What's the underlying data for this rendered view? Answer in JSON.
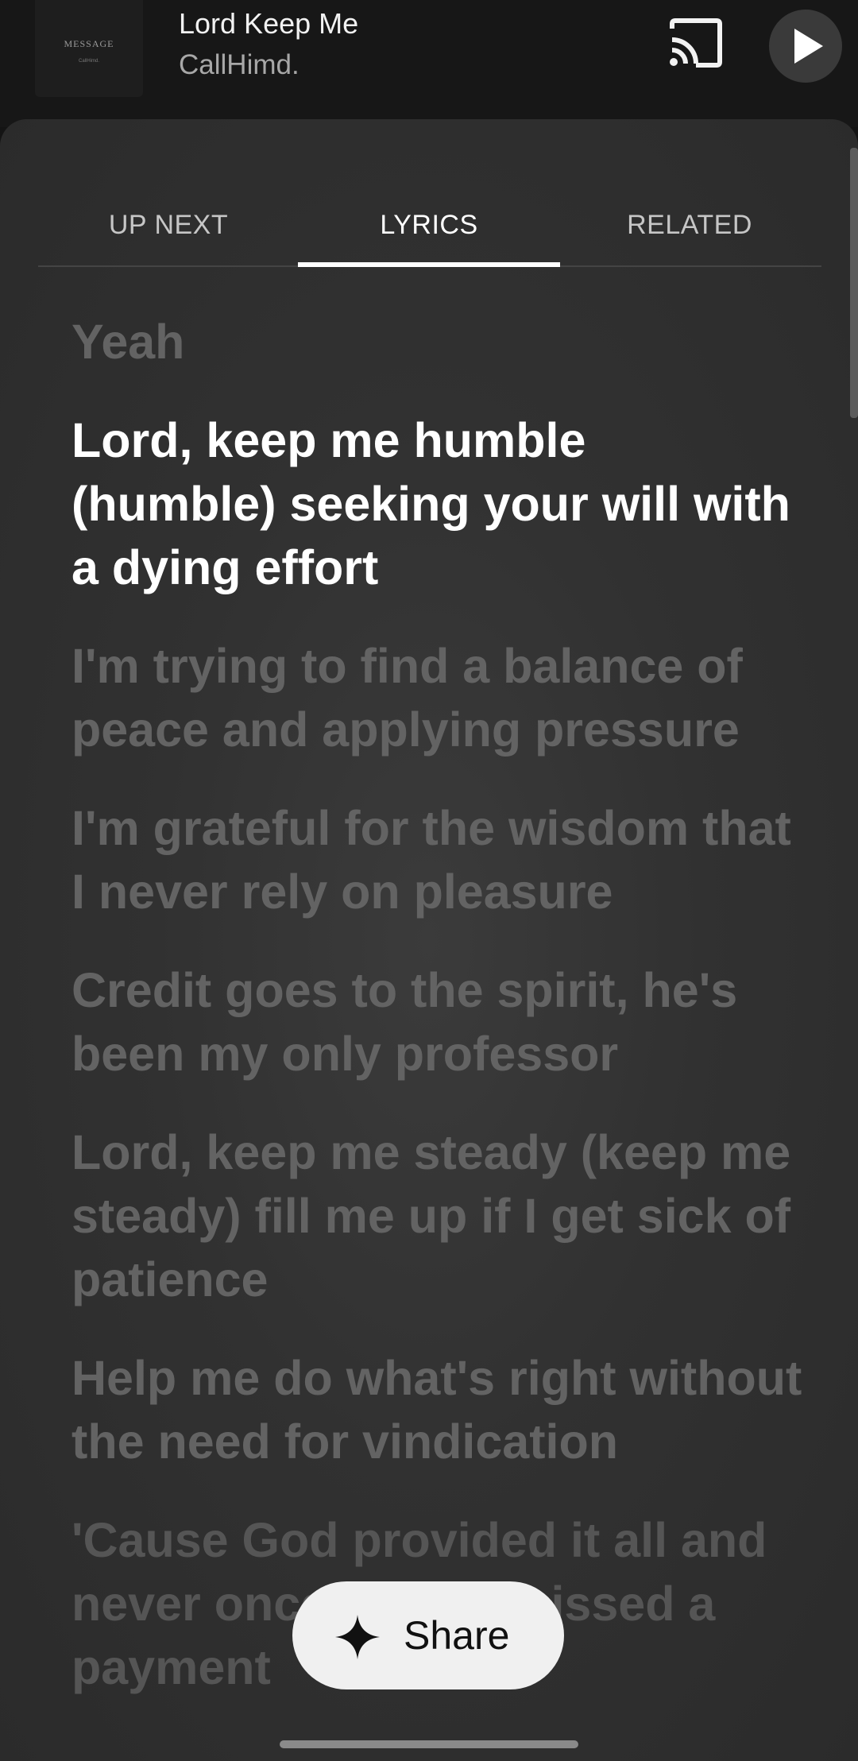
{
  "mini_player": {
    "album_art": {
      "title": "MESSAGE",
      "subtitle": "CallHimd."
    },
    "track_title": "Lord Keep Me",
    "artist": "CallHimd.",
    "cast_icon": "cast-icon",
    "play_icon": "play-icon"
  },
  "tabs": [
    {
      "label": "UP NEXT",
      "active": false
    },
    {
      "label": "LYRICS",
      "active": true
    },
    {
      "label": "RELATED",
      "active": false
    }
  ],
  "lyrics": {
    "lines": [
      {
        "text": "Yeah",
        "state": "past"
      },
      {
        "text": "Lord, keep me humble (humble) seeking your will with a dying effort",
        "state": "current"
      },
      {
        "text": "I'm trying to find a balance of peace and applying pressure",
        "state": "upcoming"
      },
      {
        "text": "I'm grateful for the wisdom that I never rely on pleasure",
        "state": "upcoming"
      },
      {
        "text": "Credit goes to the spirit, he's been my only professor",
        "state": "upcoming"
      },
      {
        "text": "Lord, keep me steady (keep me steady) fill me up if I get sick of patience",
        "state": "upcoming"
      },
      {
        "text": "Help me do what's right without the need for vindication",
        "state": "upcoming"
      },
      {
        "text": "'Cause God provided it all and never once has he missed a payment",
        "state": "upcoming"
      }
    ]
  },
  "share_button": {
    "label": "Share",
    "icon": "sparkle-icon"
  },
  "colors": {
    "background": "#2b2b2b",
    "active_lyric": "#ffffff",
    "inactive_lyric": "#636363",
    "share_button": "#f0f0f0"
  }
}
